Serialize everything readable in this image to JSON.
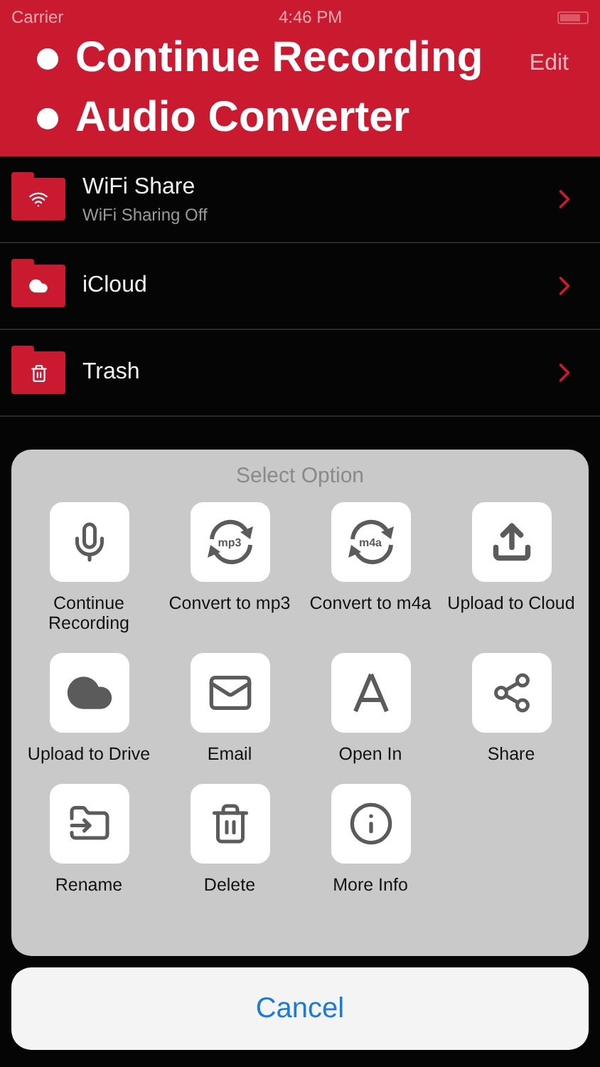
{
  "status_bar": {
    "carrier": "Carrier",
    "time": "4:46 PM"
  },
  "nav": {
    "action": "Edit"
  },
  "banner": {
    "bullets": [
      "Continue Recording",
      "Audio Converter"
    ]
  },
  "folders": [
    {
      "kind": "wifi",
      "name": "WiFi Share",
      "subtitle": "WiFi Sharing Off"
    },
    {
      "kind": "cloud",
      "name": "iCloud"
    },
    {
      "kind": "trash",
      "name": "Trash"
    }
  ],
  "sheet": {
    "title": "Select Option",
    "options": [
      {
        "kind": "record",
        "label": "Continue Recording"
      },
      {
        "kind": "mp3",
        "icon_text": "mp3",
        "label": "Convert to mp3"
      },
      {
        "kind": "m4a",
        "icon_text": "m4a",
        "label": "Convert to m4a"
      },
      {
        "kind": "upload",
        "label": "Upload to Cloud"
      },
      {
        "kind": "drive",
        "label": "Upload to Drive"
      },
      {
        "kind": "email",
        "label": "Email"
      },
      {
        "kind": "openin",
        "label": "Open In"
      },
      {
        "kind": "share",
        "label": "Share"
      },
      {
        "kind": "rename",
        "label": "Rename"
      },
      {
        "kind": "delete",
        "label": "Delete"
      },
      {
        "kind": "info",
        "label": "More Info"
      }
    ],
    "cancel": "Cancel"
  }
}
